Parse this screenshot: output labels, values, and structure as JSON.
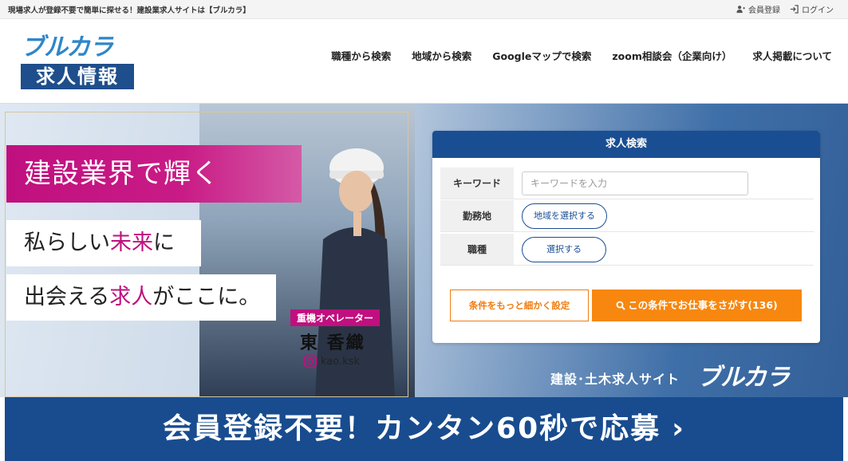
{
  "topbar": {
    "tagline": "現場求人が登録不要で簡単に探せる！建設業求人サイトは【ブルカラ】",
    "register": "会員登録",
    "login": "ログイン"
  },
  "logo": {
    "line1": "ブルカラ",
    "line2": "求人情報"
  },
  "nav": [
    "職種から検索",
    "地域から検索",
    "Googleマップで検索",
    "zoom相談会（企業向け）",
    "求人掲載について"
  ],
  "hero": {
    "slogan1": "建設業界で輝く",
    "slogan2_a": "私らしい",
    "slogan2_b": "未来",
    "slogan2_c": "に",
    "slogan3_a": "出会える",
    "slogan3_b": "求人",
    "slogan3_c": "がここに。",
    "role": "重機オペレーター",
    "name": "東 香織",
    "instagram": "kao.ksk",
    "site_caption": "建設･土木求人サイト",
    "site_logo": "ブルカラ"
  },
  "search": {
    "title": "求人検索",
    "keyword_label": "キーワード",
    "keyword_placeholder": "キーワードを入力",
    "area_label": "勤務地",
    "area_button": "地域を選択する",
    "job_label": "職種",
    "job_button": "選択する",
    "detail_button": "条件をもっと細かく設定",
    "search_button": "この条件でお仕事をさがす(136)"
  },
  "banner": {
    "text": "会員登録不要！カンタン60秒で応募",
    "chevron": "›"
  },
  "colors": {
    "navy": "#1a4e93",
    "orange": "#f7870f",
    "magenta": "#c0107f"
  }
}
